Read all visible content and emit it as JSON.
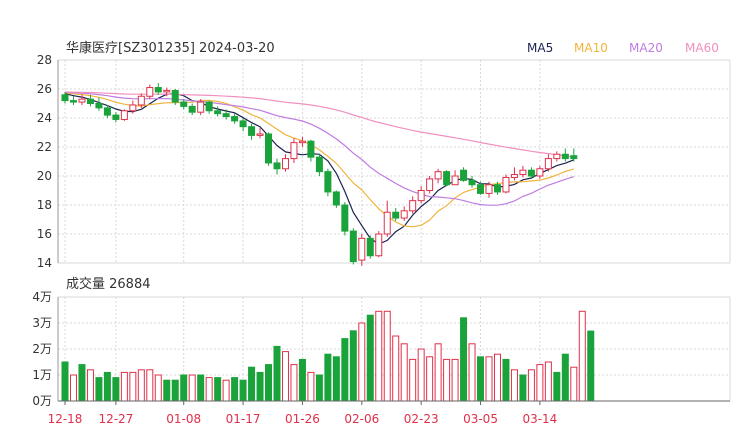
{
  "chart_data": [
    {
      "type": "candlestick",
      "title": "华康医疗[SZ301235] 2024-03-20",
      "ylim": [
        14,
        28
      ],
      "yticks": [
        "28",
        "26",
        "24",
        "22",
        "20",
        "18",
        "16",
        "14"
      ],
      "xticks": [
        "12-18",
        "12-27",
        "01-08",
        "01-17",
        "01-26",
        "02-06",
        "02-23",
        "03-05",
        "03-14"
      ],
      "xtick_index": [
        0,
        6,
        14,
        21,
        28,
        35,
        42,
        49,
        56
      ],
      "grid": true,
      "colors": {
        "up": "#e0304a",
        "down": "#1aa33a"
      },
      "legend": [
        {
          "name": "MA5",
          "color": "#1c2350"
        },
        {
          "name": "MA10",
          "color": "#f0b43c"
        },
        {
          "name": "MA20",
          "color": "#c07ce0"
        },
        {
          "name": "MA60",
          "color": "#f090c0"
        }
      ],
      "candles": [
        [
          25.6,
          25.2,
          25.8,
          25.0
        ],
        [
          25.2,
          25.1,
          25.5,
          24.9
        ],
        [
          25.1,
          25.3,
          25.6,
          24.9
        ],
        [
          25.3,
          25.0,
          25.6,
          24.8
        ],
        [
          25.0,
          24.7,
          25.4,
          24.5
        ],
        [
          24.7,
          24.2,
          24.9,
          24.0
        ],
        [
          24.2,
          23.9,
          24.4,
          23.7
        ],
        [
          23.9,
          24.5,
          24.6,
          23.8
        ],
        [
          24.5,
          24.9,
          25.2,
          24.3
        ],
        [
          24.9,
          25.5,
          25.7,
          24.7
        ],
        [
          25.5,
          26.1,
          26.3,
          25.3
        ],
        [
          26.1,
          25.8,
          26.4,
          25.6
        ],
        [
          25.8,
          25.9,
          26.1,
          25.5
        ],
        [
          25.9,
          25.1,
          26.0,
          24.9
        ],
        [
          25.1,
          24.8,
          25.3,
          24.6
        ],
        [
          24.8,
          24.4,
          25.0,
          24.2
        ],
        [
          24.4,
          25.1,
          25.3,
          24.2
        ],
        [
          25.1,
          24.5,
          25.2,
          24.3
        ],
        [
          24.5,
          24.3,
          24.8,
          24.1
        ],
        [
          24.3,
          24.1,
          24.6,
          23.9
        ],
        [
          24.1,
          23.8,
          24.3,
          23.6
        ],
        [
          23.8,
          23.4,
          24.0,
          23.1
        ],
        [
          23.4,
          22.8,
          23.6,
          22.5
        ],
        [
          22.8,
          22.9,
          23.3,
          22.6
        ],
        [
          22.9,
          20.9,
          23.0,
          20.7
        ],
        [
          20.9,
          20.5,
          21.2,
          20.1
        ],
        [
          20.5,
          21.2,
          21.5,
          20.3
        ],
        [
          21.2,
          22.3,
          22.6,
          20.9
        ],
        [
          22.3,
          22.4,
          22.7,
          22.0
        ],
        [
          22.4,
          21.3,
          22.5,
          21.0
        ],
        [
          21.3,
          20.3,
          21.5,
          20.0
        ],
        [
          20.3,
          18.9,
          20.5,
          18.6
        ],
        [
          18.9,
          18.0,
          19.0,
          17.8
        ],
        [
          18.0,
          16.2,
          18.2,
          15.9
        ],
        [
          16.2,
          14.1,
          16.4,
          13.9
        ],
        [
          14.2,
          15.7,
          16.0,
          13.8
        ],
        [
          15.7,
          14.5,
          15.9,
          14.3
        ],
        [
          14.5,
          16.0,
          16.2,
          14.4
        ],
        [
          16.0,
          17.5,
          18.3,
          15.8
        ],
        [
          17.5,
          17.1,
          17.8,
          16.9
        ],
        [
          17.1,
          17.6,
          17.9,
          16.9
        ],
        [
          17.6,
          18.3,
          18.6,
          17.4
        ],
        [
          18.3,
          19.0,
          19.3,
          18.1
        ],
        [
          19.0,
          19.8,
          20.0,
          18.8
        ],
        [
          19.8,
          20.3,
          20.5,
          19.5
        ],
        [
          20.3,
          19.4,
          20.4,
          19.3
        ],
        [
          19.4,
          20.0,
          20.4,
          19.4
        ],
        [
          20.4,
          19.7,
          20.6,
          19.6
        ],
        [
          19.7,
          19.4,
          20.0,
          19.2
        ],
        [
          19.4,
          18.8,
          19.6,
          18.7
        ],
        [
          18.8,
          19.4,
          19.6,
          18.5
        ],
        [
          19.4,
          18.9,
          19.6,
          18.7
        ],
        [
          18.9,
          19.9,
          20.1,
          18.8
        ],
        [
          19.9,
          20.1,
          20.6,
          19.7
        ],
        [
          20.1,
          20.4,
          20.7,
          19.9
        ],
        [
          20.4,
          20.0,
          20.6,
          19.8
        ],
        [
          20.0,
          20.5,
          20.7,
          19.8
        ],
        [
          20.5,
          21.2,
          21.5,
          20.3
        ],
        [
          21.2,
          21.5,
          21.7,
          21.0
        ],
        [
          21.5,
          21.2,
          21.9,
          21.0
        ],
        [
          21.4,
          21.2,
          21.9,
          21.0
        ]
      ]
    },
    {
      "type": "bar",
      "title": "成交量 26884",
      "ylim": [
        0,
        40000
      ],
      "yticks": [
        "4万",
        "3万",
        "2万",
        "1万",
        "0万"
      ],
      "volumes": [
        [
          15000,
          "down"
        ],
        [
          10000,
          "up"
        ],
        [
          14000,
          "down"
        ],
        [
          12000,
          "up"
        ],
        [
          9000,
          "down"
        ],
        [
          11000,
          "down"
        ],
        [
          9000,
          "down"
        ],
        [
          11000,
          "up"
        ],
        [
          11000,
          "up"
        ],
        [
          12000,
          "up"
        ],
        [
          12000,
          "up"
        ],
        [
          10000,
          "up"
        ],
        [
          8000,
          "down"
        ],
        [
          8000,
          "down"
        ],
        [
          10000,
          "down"
        ],
        [
          10000,
          "up"
        ],
        [
          10000,
          "down"
        ],
        [
          9000,
          "up"
        ],
        [
          9000,
          "down"
        ],
        [
          8000,
          "up"
        ],
        [
          9000,
          "down"
        ],
        [
          8000,
          "down"
        ],
        [
          13000,
          "down"
        ],
        [
          11000,
          "down"
        ],
        [
          14000,
          "down"
        ],
        [
          21000,
          "down"
        ],
        [
          19000,
          "up"
        ],
        [
          14000,
          "up"
        ],
        [
          16000,
          "down"
        ],
        [
          11000,
          "up"
        ],
        [
          10000,
          "down"
        ],
        [
          18000,
          "down"
        ],
        [
          17000,
          "down"
        ],
        [
          24000,
          "down"
        ],
        [
          27000,
          "down"
        ],
        [
          30000,
          "up"
        ],
        [
          33000,
          "down"
        ],
        [
          34500,
          "up"
        ],
        [
          34500,
          "up"
        ],
        [
          25000,
          "up"
        ],
        [
          22000,
          "up"
        ],
        [
          16000,
          "up"
        ],
        [
          20000,
          "up"
        ],
        [
          17000,
          "up"
        ],
        [
          22000,
          "up"
        ],
        [
          16000,
          "up"
        ],
        [
          16000,
          "up"
        ],
        [
          32000,
          "down"
        ],
        [
          22000,
          "up"
        ],
        [
          17000,
          "down"
        ],
        [
          17000,
          "up"
        ],
        [
          18000,
          "up"
        ],
        [
          16000,
          "down"
        ],
        [
          12000,
          "up"
        ],
        [
          10000,
          "down"
        ],
        [
          12000,
          "up"
        ],
        [
          14000,
          "up"
        ],
        [
          15000,
          "up"
        ],
        [
          11000,
          "down"
        ],
        [
          18000,
          "down"
        ],
        [
          13000,
          "up"
        ],
        [
          34500,
          "up"
        ],
        [
          26884,
          "down"
        ]
      ]
    }
  ]
}
